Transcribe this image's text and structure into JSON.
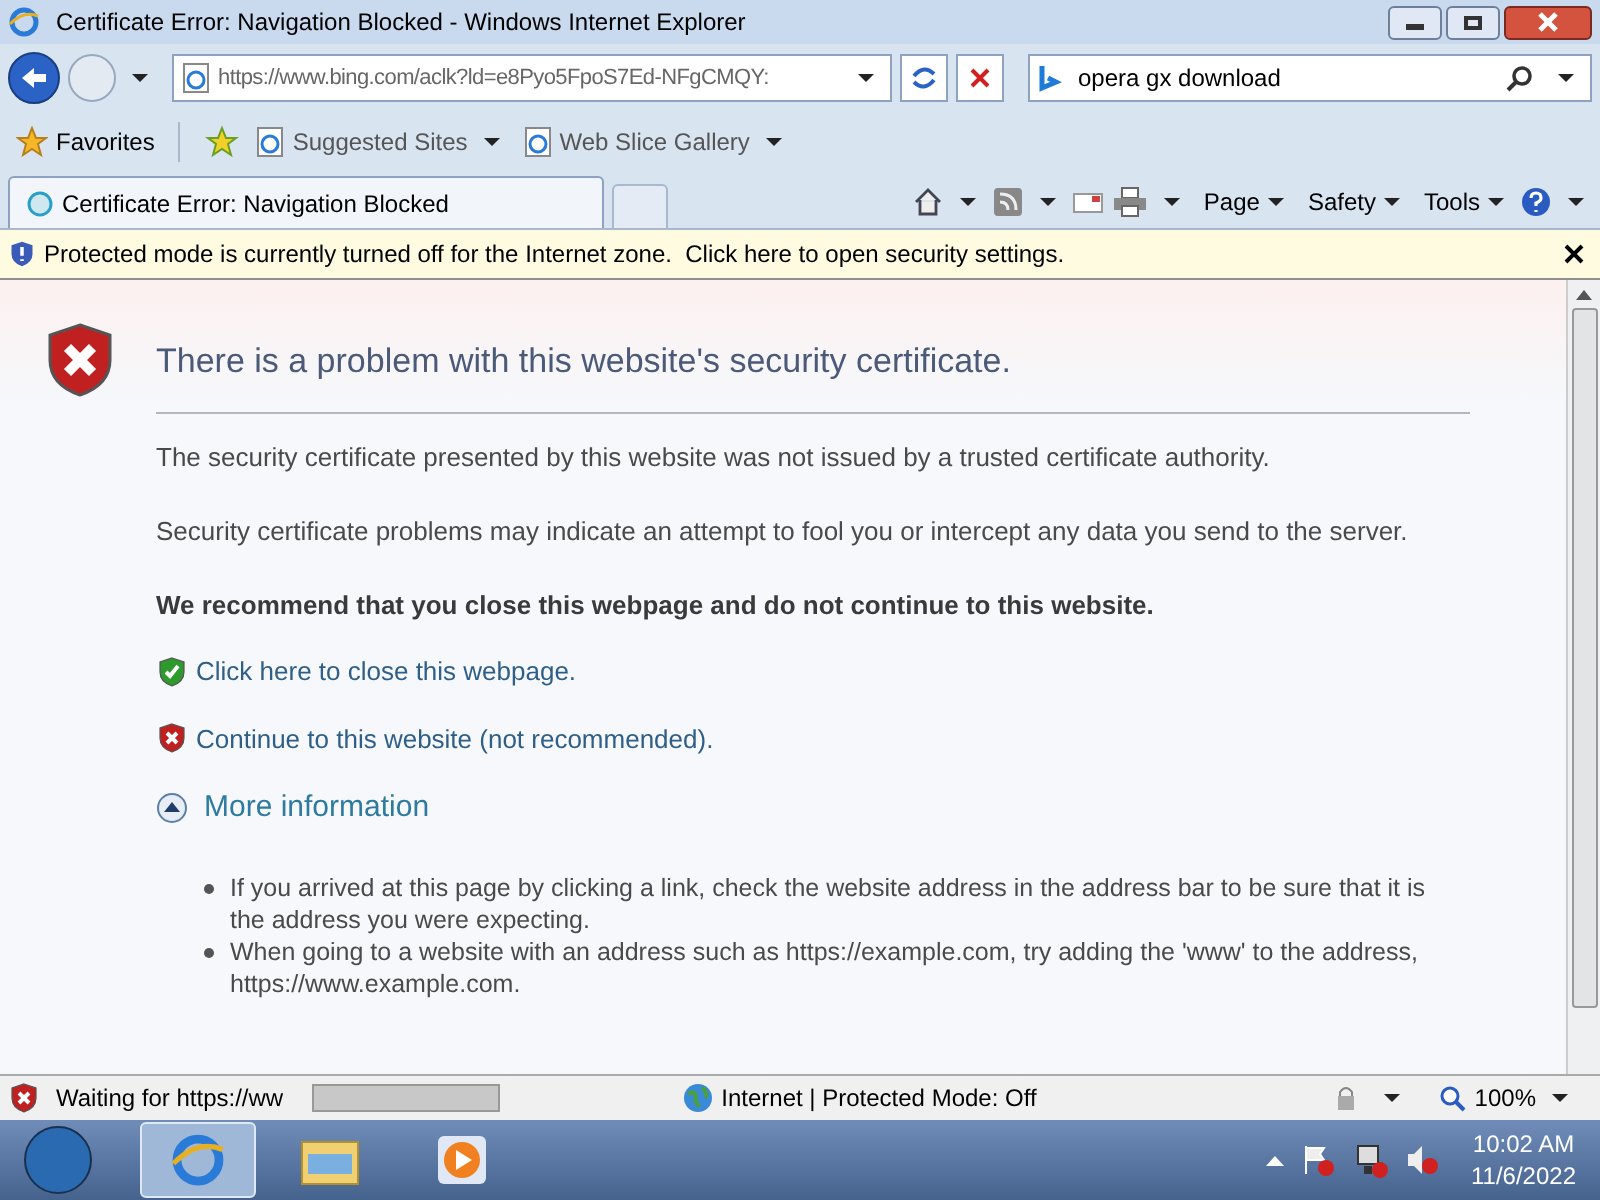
{
  "window": {
    "title": "Certificate Error: Navigation Blocked - Windows Internet Explorer"
  },
  "address": {
    "value": "https://www.bing.com/aclk?ld=e8Pyo5FpoS7Ed-NFgCMQY:"
  },
  "search": {
    "value": "opera gx download"
  },
  "favorites_bar": {
    "favorites": "Favorites",
    "items": [
      {
        "label": "Suggested Sites"
      },
      {
        "label": "Web Slice Gallery"
      }
    ]
  },
  "tabs": [
    {
      "label": "Certificate Error: Navigation Blocked",
      "selected": true
    }
  ],
  "command_bar": [
    "Page",
    "Safety",
    "Tools"
  ],
  "info_bar": "Protected mode is currently turned off for the Internet zone.  Click here to open security settings.",
  "page": {
    "heading": "There is a problem with this website's security certificate.",
    "paragraphs": [
      "The security certificate presented by this website was not issued by a trusted certificate authority.",
      "Security certificate problems may indicate an attempt to fool you or intercept any data you send to the server."
    ],
    "recommendation": "We recommend that you close this webpage and do not continue to this website.",
    "links": [
      {
        "kind": "safe",
        "label": "Click here to close this webpage."
      },
      {
        "kind": "unsafe",
        "label": "Continue to this website (not recommended)."
      }
    ],
    "more_info": {
      "label": "More information",
      "expanded": true
    },
    "bullets": [
      "If you arrived at this page by clicking a link, check the website address in the address bar to be sure that it is the address you were expecting.",
      "When going to a website with an address such as https://example.com, try adding the 'www' to the address, https://www.example.com."
    ]
  },
  "status_bar": {
    "text": "Waiting for https://ww",
    "progress": {
      "level": 1
    },
    "zone": "Internet | Protected Mode: Off",
    "zoom": "100%"
  },
  "taskbar": {
    "time": "10:02 AM",
    "date": "11/6/2022"
  }
}
